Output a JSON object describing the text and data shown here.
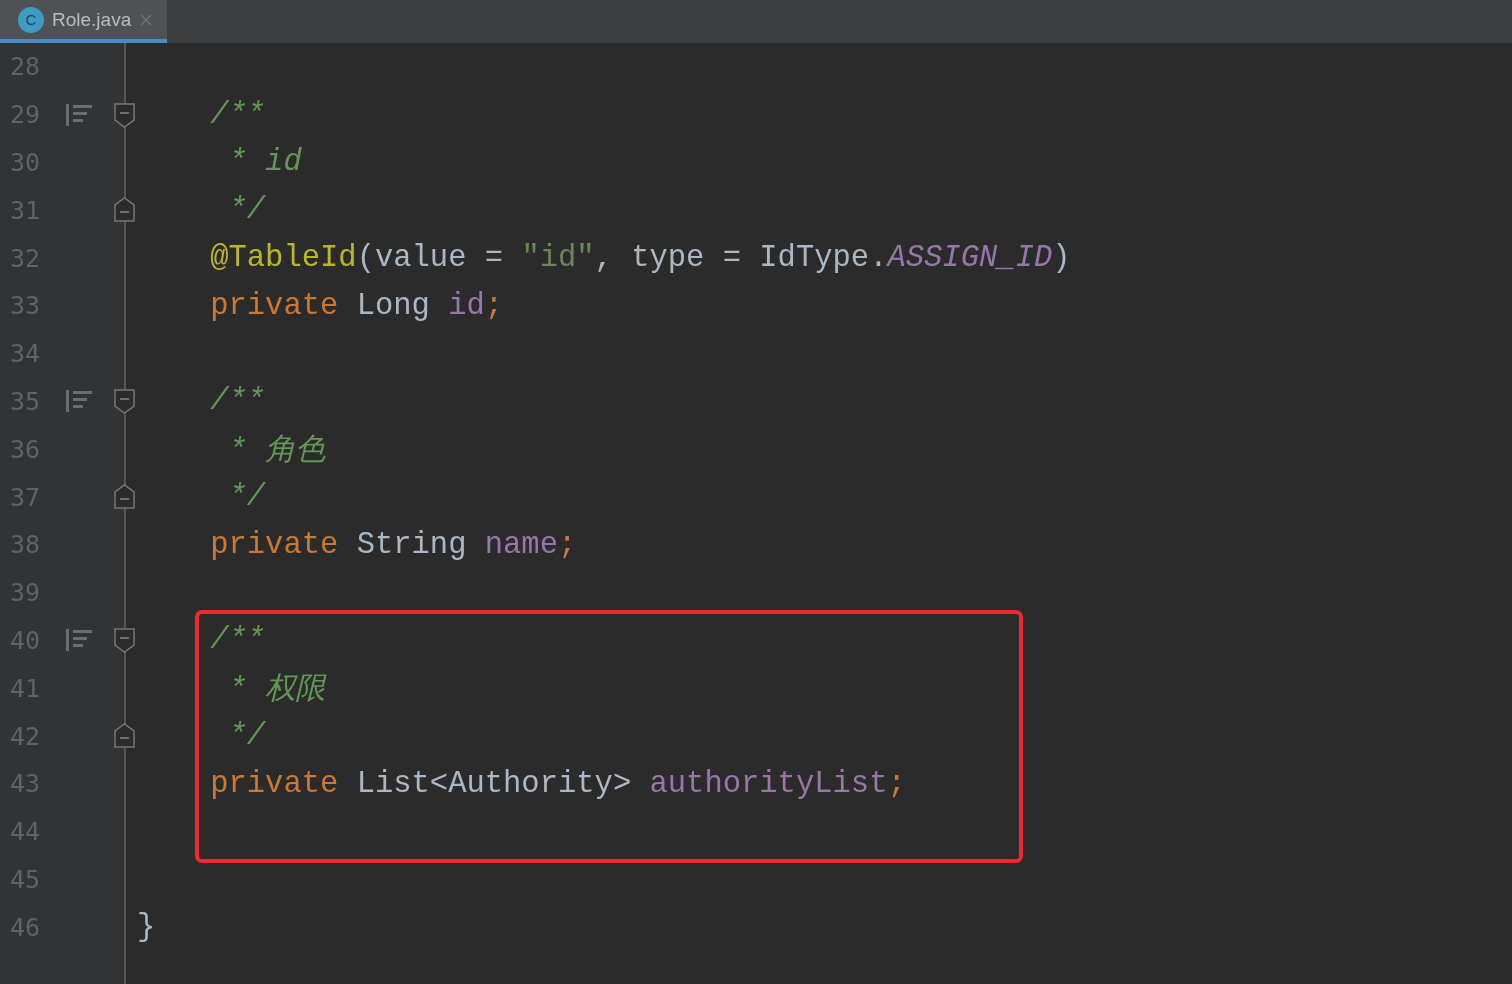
{
  "tabs": [
    {
      "icon_letter": "C",
      "label": "Role.java",
      "selected": true
    }
  ],
  "blocks": [
    {
      "highlighted": false,
      "lines": [
        {
          "number": "28"
        },
        {
          "number": "29",
          "doc_marker": true,
          "fold_start": true,
          "tokens": [
            {
              "text": "    /**",
              "kind": "comment"
            }
          ]
        },
        {
          "number": "30",
          "tokens": [
            {
              "text": "     * id",
              "kind": "comment"
            }
          ]
        },
        {
          "number": "31",
          "fold_end": true,
          "tokens": [
            {
              "text": "     */",
              "kind": "comment"
            }
          ]
        },
        {
          "number": "32",
          "tokens": [
            {
              "text": "    @TableId",
              "kind": "annotation"
            },
            {
              "text": "(value = ",
              "kind": "plain"
            },
            {
              "text": "\"id\"",
              "kind": "string"
            },
            {
              "text": ", type = IdType.",
              "kind": "plain"
            },
            {
              "text": "ASSIGN_ID",
              "kind": "constant"
            },
            {
              "text": ")",
              "kind": "plain"
            }
          ]
        },
        {
          "number": "33",
          "tokens": [
            {
              "text": "    private ",
              "kind": "keyword"
            },
            {
              "text": "Long ",
              "kind": "plain"
            },
            {
              "text": "id",
              "kind": "field"
            },
            {
              "text": ";",
              "kind": "keyword"
            }
          ]
        },
        {
          "number": "34"
        },
        {
          "number": "35",
          "doc_marker": true,
          "fold_start": true,
          "tokens": [
            {
              "text": "    /**",
              "kind": "comment"
            }
          ]
        },
        {
          "number": "36",
          "tokens": [
            {
              "text": "     * 角色",
              "kind": "comment"
            }
          ]
        },
        {
          "number": "37",
          "fold_end": true,
          "tokens": [
            {
              "text": "     */",
              "kind": "comment"
            }
          ]
        },
        {
          "number": "38",
          "tokens": [
            {
              "text": "    private ",
              "kind": "keyword"
            },
            {
              "text": "String ",
              "kind": "plain"
            },
            {
              "text": "name",
              "kind": "field"
            },
            {
              "text": ";",
              "kind": "keyword"
            }
          ]
        },
        {
          "number": "39"
        }
      ]
    },
    {
      "highlighted": true,
      "lines": [
        {
          "number": "40",
          "doc_marker": true,
          "fold_start": true,
          "tokens": [
            {
              "text": "    /**",
              "kind": "comment"
            }
          ]
        },
        {
          "number": "41",
          "tokens": [
            {
              "text": "     * 权限",
              "kind": "comment"
            }
          ]
        },
        {
          "number": "42",
          "fold_end": true,
          "tokens": [
            {
              "text": "     */",
              "kind": "comment"
            }
          ]
        },
        {
          "number": "43",
          "tokens": [
            {
              "text": "    private ",
              "kind": "keyword"
            },
            {
              "text": "List<Authority> ",
              "kind": "plain"
            },
            {
              "text": "authorityList",
              "kind": "field"
            },
            {
              "text": ";",
              "kind": "keyword"
            }
          ]
        },
        {
          "number": "44"
        }
      ]
    },
    {
      "highlighted": false,
      "lines": [
        {
          "number": "45"
        },
        {
          "number": "46",
          "tokens": [
            {
              "text": "}",
              "kind": "plain"
            }
          ]
        }
      ]
    }
  ]
}
